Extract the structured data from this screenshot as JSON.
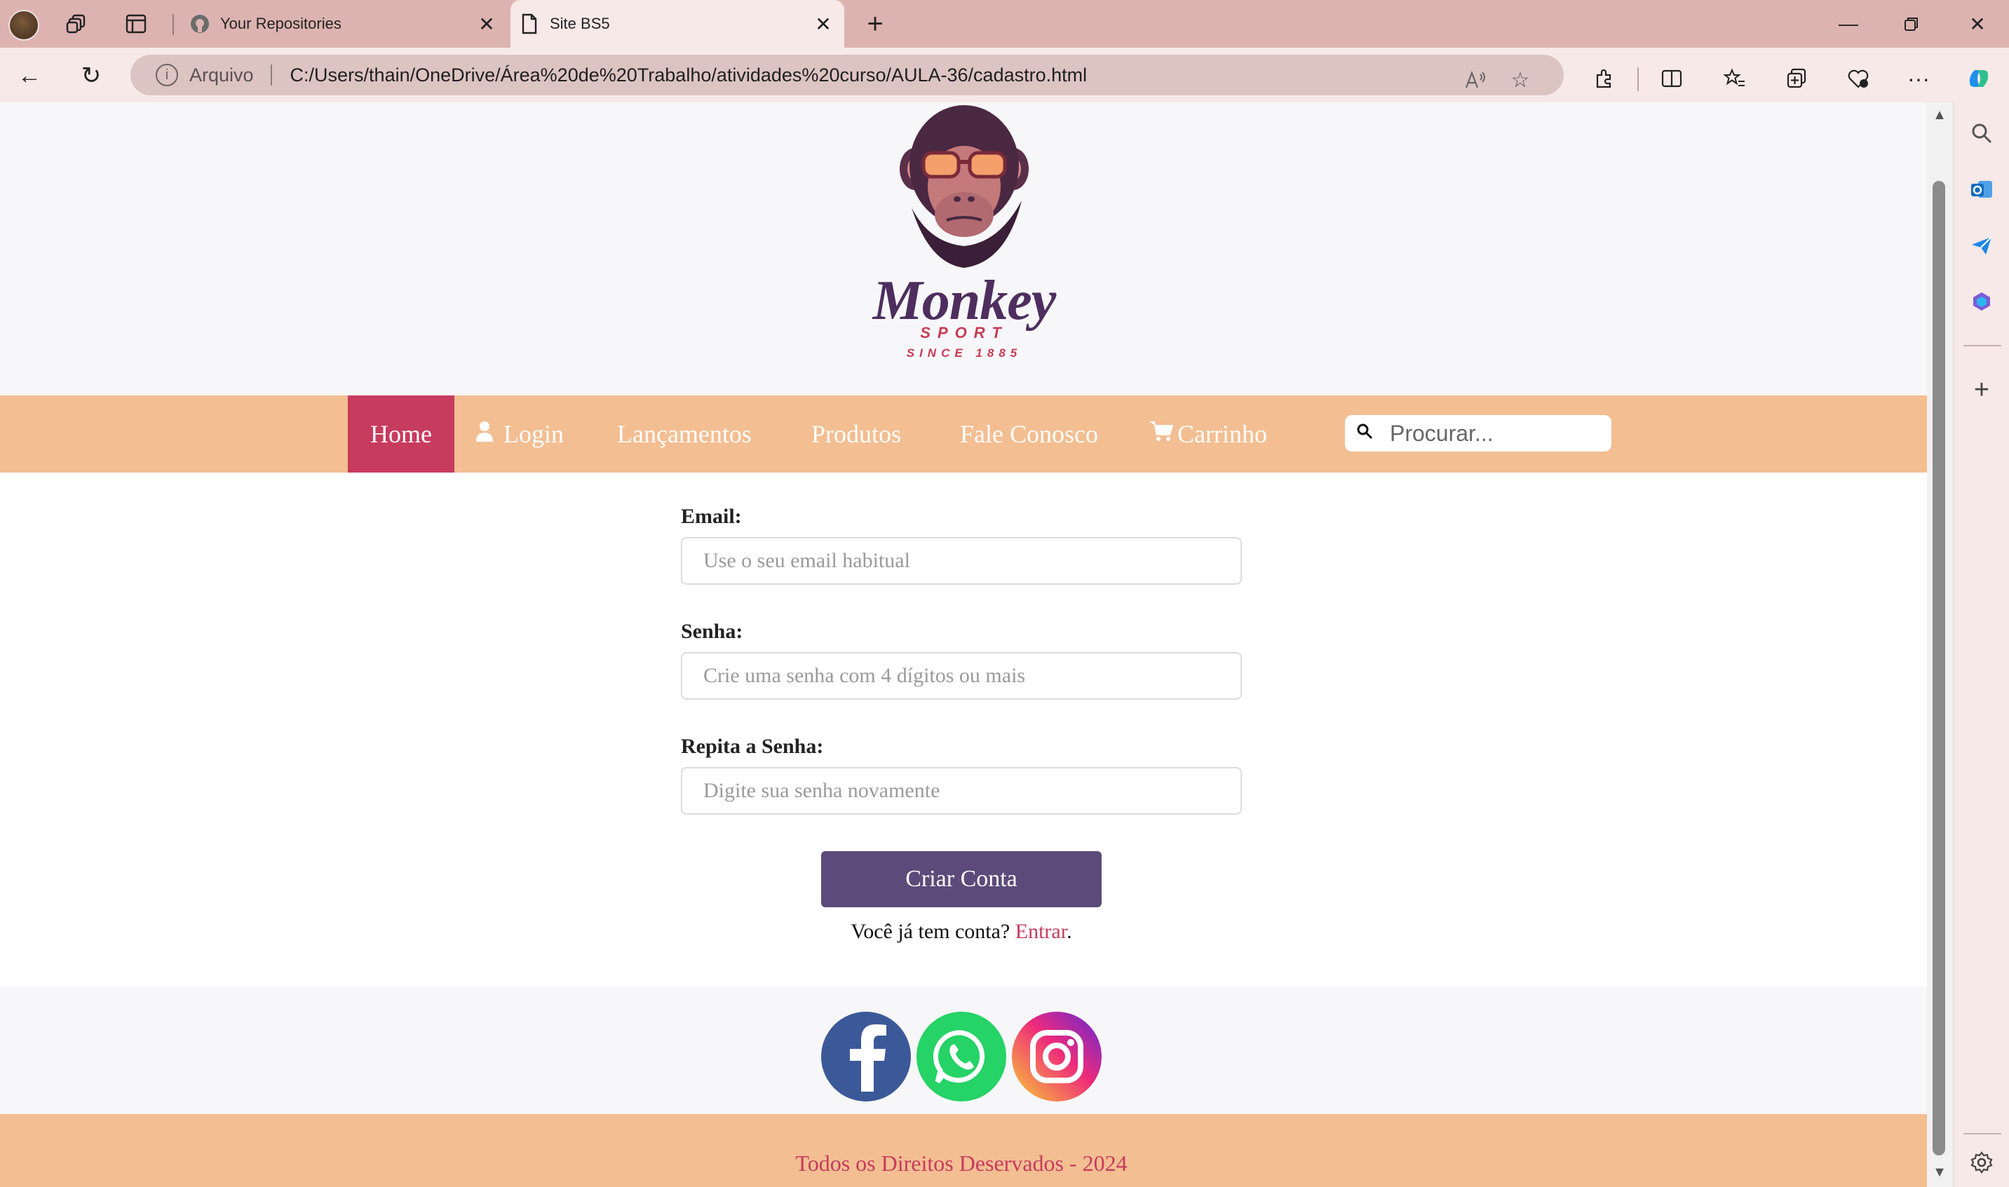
{
  "browser": {
    "tabs": [
      {
        "title": "Your Repositories",
        "active": false,
        "favicon": "github-icon"
      },
      {
        "title": "Site BS5",
        "active": true,
        "favicon": "page-icon"
      }
    ],
    "address": {
      "scheme_label": "Arquivo",
      "url": "C:/Users/thain/OneDrive/Área%20de%20Trabalho/atividades%20curso/AULA-36/cadastro.html"
    }
  },
  "logo": {
    "word": "Monkey",
    "sub": "SPORT",
    "since": "SINCE 1885"
  },
  "nav": {
    "items": [
      {
        "label": "Home",
        "active": true
      },
      {
        "label": "Login",
        "icon": "user-icon"
      },
      {
        "label": "Lançamentos"
      },
      {
        "label": "Produtos"
      },
      {
        "label": "Fale Conosco"
      },
      {
        "label": "Carrinho",
        "icon": "cart-icon"
      }
    ],
    "search_placeholder": "Procurar..."
  },
  "form": {
    "email_label": "Email:",
    "email_placeholder": "Use o seu email habitual",
    "password_label": "Senha:",
    "password_placeholder": "Crie uma senha com 4 dígitos ou mais",
    "repeat_label": "Repita a Senha:",
    "repeat_placeholder": "Digite sua senha novamente",
    "submit_label": "Criar Conta",
    "login_prompt": "Você já tem conta?",
    "login_link": "Entrar",
    "login_suffix": "."
  },
  "social": [
    {
      "name": "facebook-icon"
    },
    {
      "name": "whatsapp-icon"
    },
    {
      "name": "instagram-icon"
    }
  ],
  "footer": {
    "text": "Todos os Direitos Deservados - 2024"
  },
  "colors": {
    "accent": "#c73b5e",
    "nav_bg": "#f3be92",
    "button": "#5c4a7a",
    "chrome": "#dcb3b0"
  }
}
